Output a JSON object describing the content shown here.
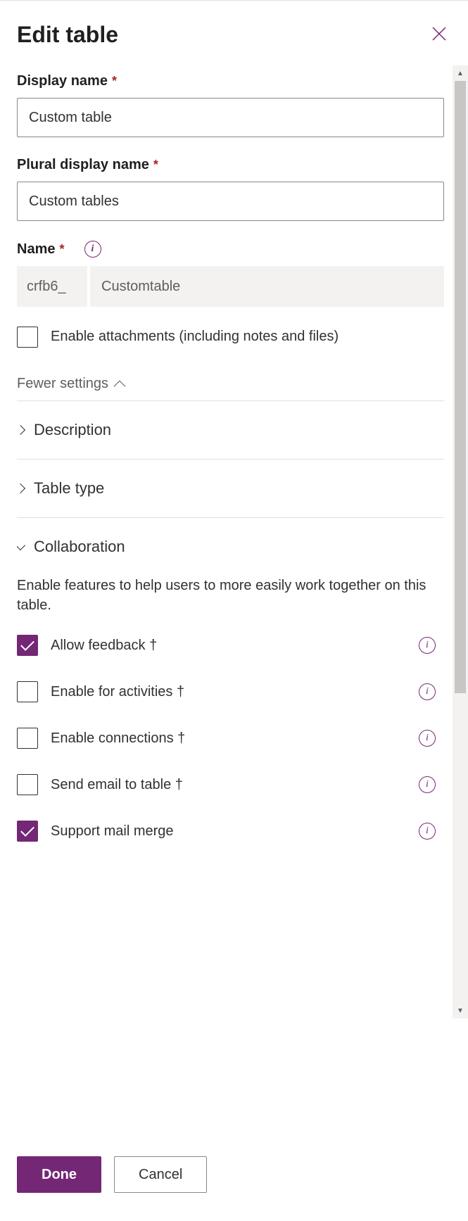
{
  "header": {
    "title": "Edit table"
  },
  "fields": {
    "display_name": {
      "label": "Display name",
      "value": "Custom table"
    },
    "plural_display_name": {
      "label": "Plural display name",
      "value": "Custom tables"
    },
    "name": {
      "label": "Name",
      "prefix": "crfb6_",
      "value": "Customtable"
    },
    "enable_attachments": {
      "label": "Enable attachments (including notes and files)",
      "checked": false
    }
  },
  "fewer_settings_label": "Fewer settings",
  "sections": {
    "description": {
      "label": "Description"
    },
    "table_type": {
      "label": "Table type"
    },
    "collaboration": {
      "label": "Collaboration",
      "description": "Enable features to help users to more easily work together on this table.",
      "options": [
        {
          "label": "Allow feedback †",
          "checked": true
        },
        {
          "label": "Enable for activities †",
          "checked": false
        },
        {
          "label": "Enable connections †",
          "checked": false
        },
        {
          "label": "Send email to table †",
          "checked": false
        },
        {
          "label": "Support mail merge",
          "checked": true
        }
      ]
    }
  },
  "footer": {
    "done": "Done",
    "cancel": "Cancel"
  }
}
